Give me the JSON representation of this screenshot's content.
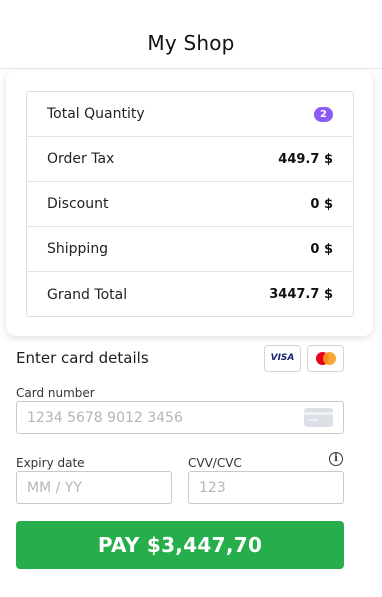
{
  "header": {
    "title": "My Shop"
  },
  "summary": {
    "rows": [
      {
        "label": "Total Quantity",
        "value": "2",
        "type": "badge"
      },
      {
        "label": "Order Tax",
        "value": "449.7 $"
      },
      {
        "label": "Discount",
        "value": "0 $"
      },
      {
        "label": "Shipping",
        "value": "0 $"
      },
      {
        "label": "Grand Total",
        "value": "3447.7 $"
      }
    ]
  },
  "payment": {
    "heading": "Enter card details",
    "brands": {
      "visa": "VISA",
      "mastercard_icon": "mastercard-icon"
    },
    "card_number": {
      "label": "Card number",
      "placeholder": "1234 5678 9012 3456",
      "value": ""
    },
    "expiry": {
      "label": "Expiry date",
      "placeholder": "MM / YY",
      "value": ""
    },
    "cvc": {
      "label": "CVV/CVC",
      "placeholder": "123",
      "value": "",
      "info_icon": "info-icon"
    },
    "pay_label": "PAY $3,447,70"
  },
  "colors": {
    "accent_green": "#26ae4c",
    "badge_purple": "#8a5cf6",
    "visa_blue": "#1a1f71",
    "mc_red": "#eb001b",
    "mc_orange": "#f79e1b"
  }
}
